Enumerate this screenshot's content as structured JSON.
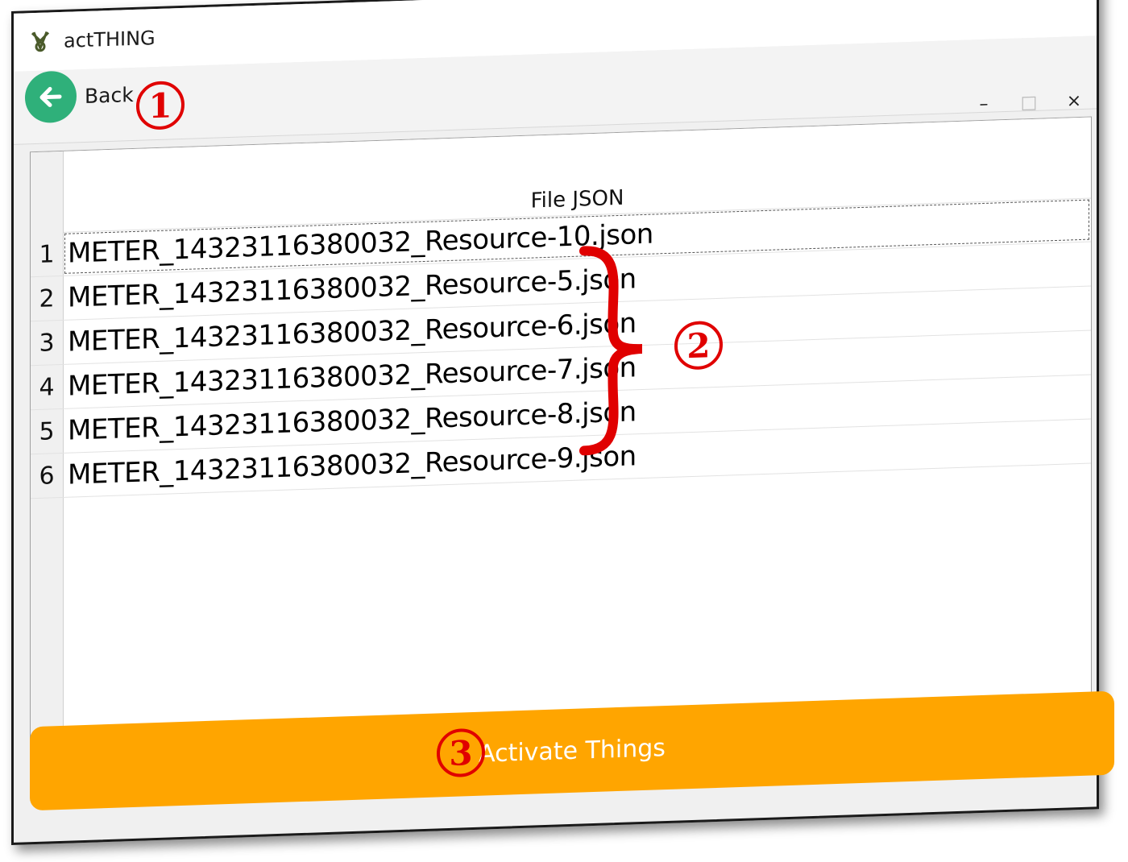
{
  "window": {
    "title": "actTHING",
    "controls": {
      "minimize": "–",
      "maximize": "□",
      "close": "×"
    }
  },
  "toolbar": {
    "back_label": "Back"
  },
  "grid": {
    "column_header": "File JSON",
    "rows": [
      {
        "num": "1",
        "file": "METER_14323116380032_Resource-10.json"
      },
      {
        "num": "2",
        "file": "METER_14323116380032_Resource-5.json"
      },
      {
        "num": "3",
        "file": "METER_14323116380032_Resource-6.json"
      },
      {
        "num": "4",
        "file": "METER_14323116380032_Resource-7.json"
      },
      {
        "num": "5",
        "file": "METER_14323116380032_Resource-8.json"
      },
      {
        "num": "6",
        "file": "METER_14323116380032_Resource-9.json"
      }
    ]
  },
  "activate_button": {
    "label": "Activate Things"
  },
  "annotations": {
    "one": "1",
    "two": "2",
    "three": "3"
  },
  "colors": {
    "accent": "#ffa500",
    "back_button": "#2fb07a",
    "annotation": "#e00000"
  }
}
